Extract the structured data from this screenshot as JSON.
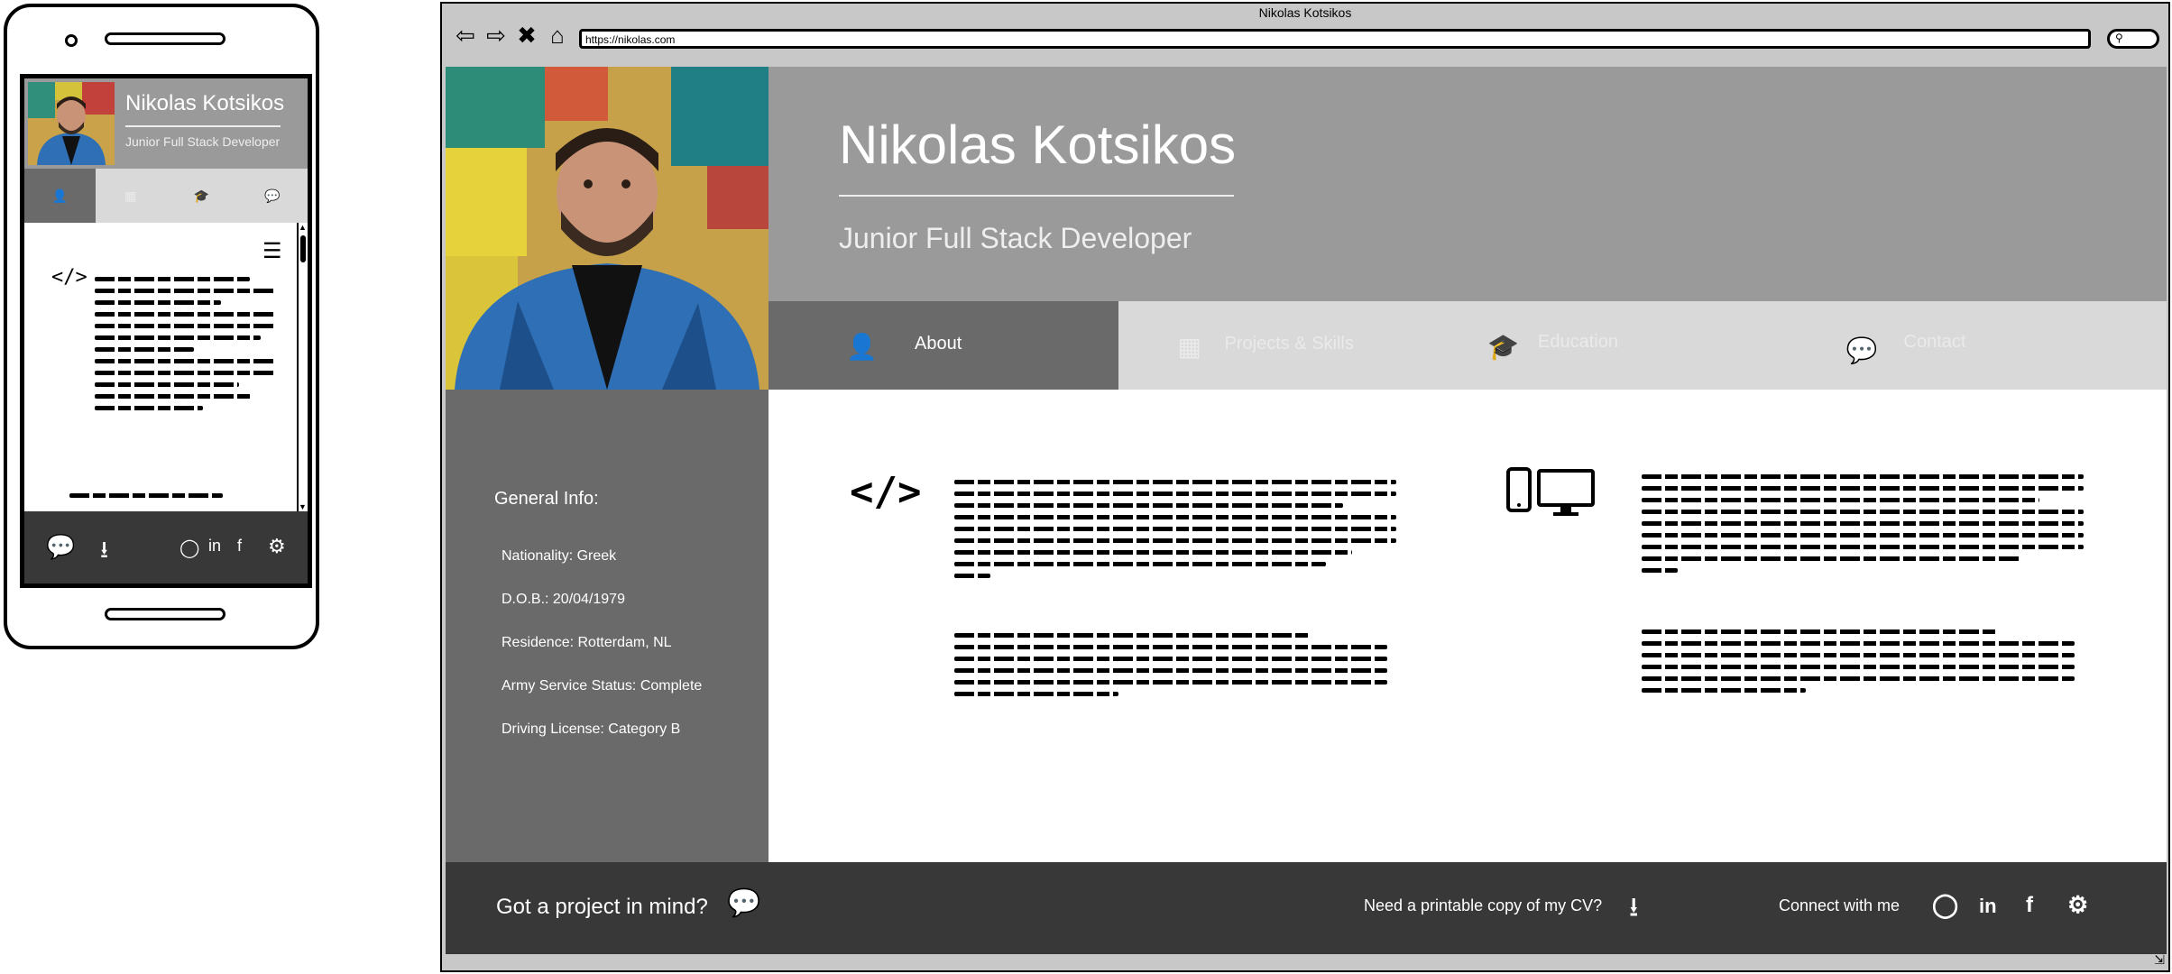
{
  "window": {
    "title": "Nikolas Kotsikos"
  },
  "browser": {
    "url": "https://nikolas.com",
    "nav_icons": [
      "back-arrow-icon",
      "forward-arrow-icon",
      "stop-icon",
      "home-icon"
    ],
    "search_icon": "search-icon"
  },
  "profile": {
    "name": "Nikolas Kotsikos",
    "title": "Junior Full Stack Developer"
  },
  "tabs": [
    {
      "label": "About",
      "icon": "user-icon",
      "active": true
    },
    {
      "label": "Projects & Skills",
      "icon": "server-icon",
      "active": false
    },
    {
      "label": "Education",
      "icon": "graduation-cap-icon",
      "active": false
    },
    {
      "label": "Contact",
      "icon": "chat-bubble-icon",
      "active": false
    }
  ],
  "general_info": {
    "heading": "General Info:",
    "items": [
      "Nationality: Greek",
      "D.O.B.: 20/04/1979",
      "Residence: Rotterdam, NL",
      "Army Service Status: Complete",
      "Driving License: Category B"
    ]
  },
  "about": {
    "code_icon": "code-icon",
    "devices_icon": "devices-icon"
  },
  "footer": {
    "cta": "Got a project in mind?",
    "cv": "Need a printable copy of my CV?",
    "connect": "Connect with me",
    "social_icons": [
      "github-icon",
      "linkedin-icon",
      "facebook-icon",
      "settings-icon"
    ]
  },
  "colors": {
    "header_gray": "#9a9a9a",
    "active_tab": "#6a6a6a",
    "inactive_tab": "#d9d9d9",
    "sidebar": "#6a6a6a",
    "footer": "#383838"
  }
}
